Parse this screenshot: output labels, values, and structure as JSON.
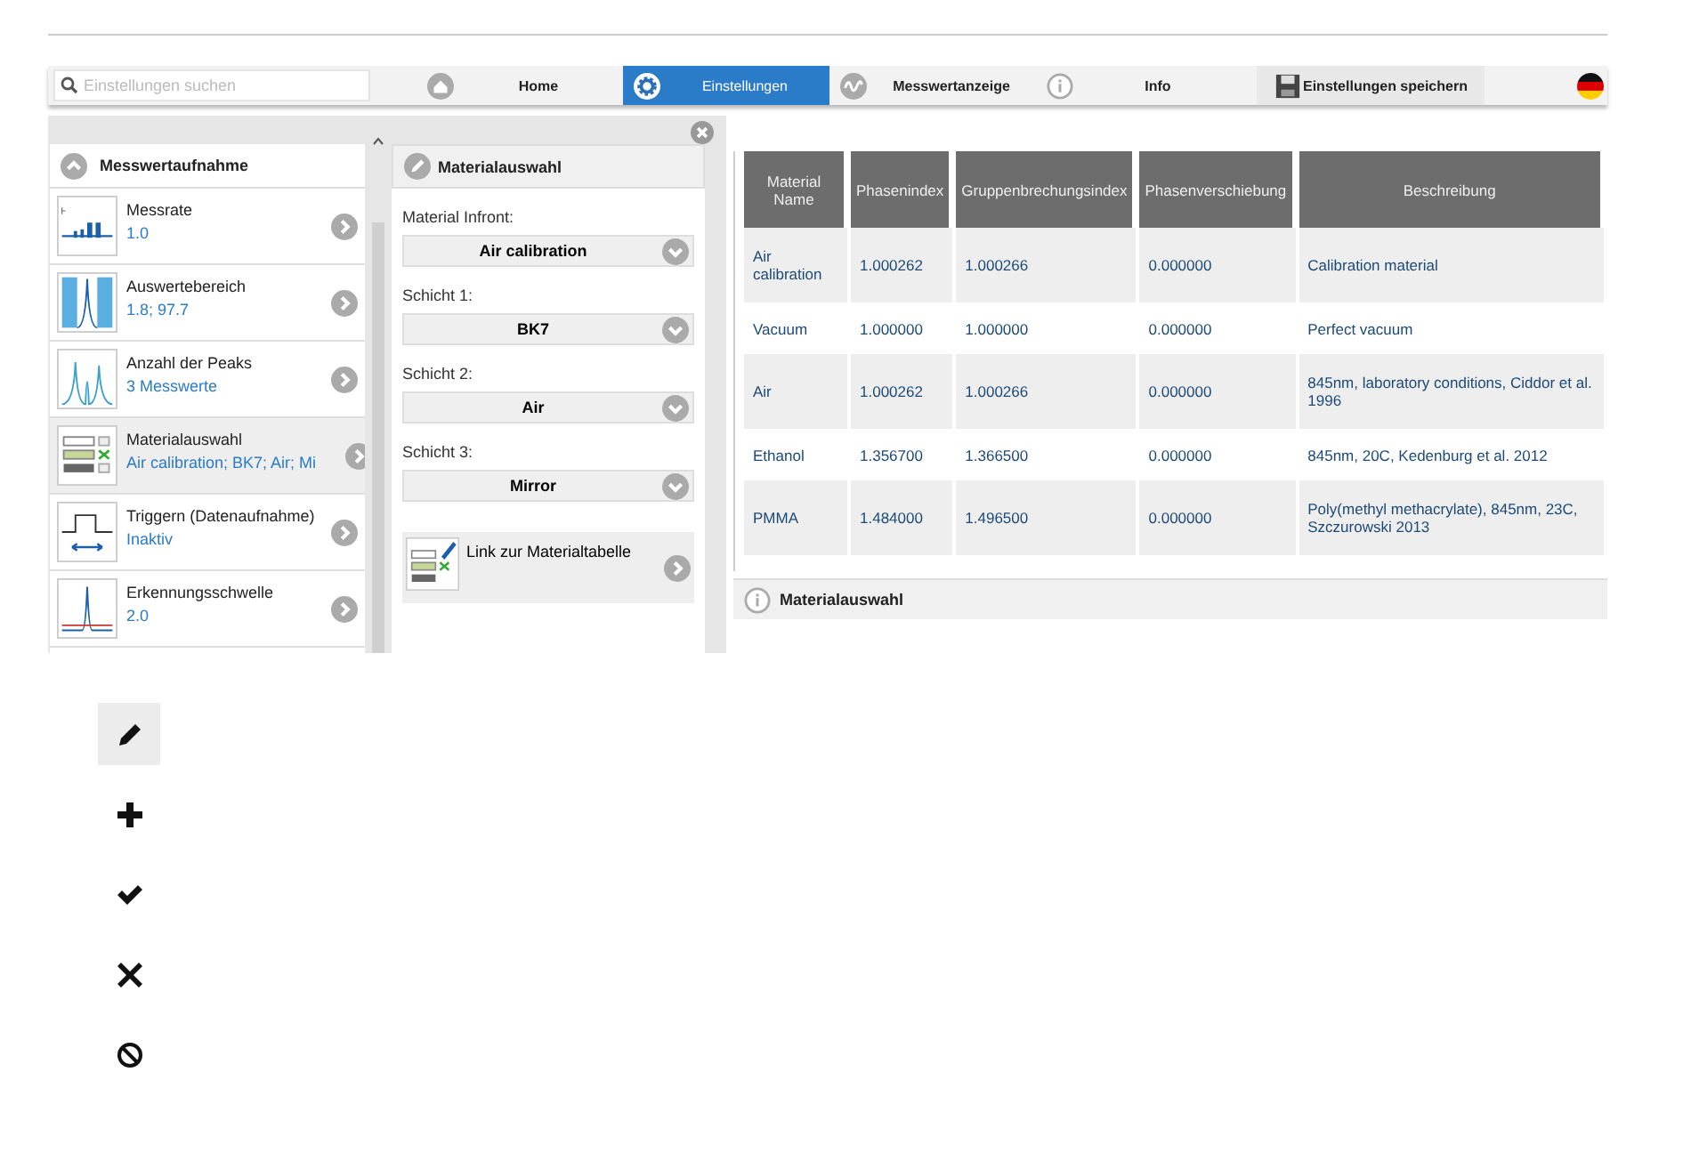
{
  "search": {
    "placeholder": "Einstellungen suchen"
  },
  "nav": [
    {
      "label": "Home",
      "kind": "home",
      "selected": false
    },
    {
      "label": "Einstellungen",
      "kind": "gear",
      "selected": true
    },
    {
      "label": "Messwertanzeige",
      "kind": "wave",
      "selected": false
    },
    {
      "label": "Info",
      "kind": "info",
      "selected": false
    }
  ],
  "save_button": {
    "label": "Einstellungen speichern"
  },
  "settings_list": {
    "title": "Messwertaufnahme",
    "items": [
      {
        "kind": "rate",
        "title": "Messrate",
        "value": "1.0",
        "selected": false
      },
      {
        "kind": "range",
        "title": "Auswertebereich",
        "value": "1.8; 97.7",
        "selected": false
      },
      {
        "kind": "peaks",
        "title": "Anzahl der Peaks",
        "value": "3 Messwerte",
        "selected": false
      },
      {
        "kind": "material",
        "title": "Materialauswahl",
        "value": "Air calibration; BK7; Air; Mi",
        "selected": true
      },
      {
        "kind": "trigger",
        "title": "Triggern (Datenaufnahme)",
        "value": "Inaktiv",
        "selected": false
      },
      {
        "kind": "threshold",
        "title": "Erkennungsschwelle",
        "value": "2.0",
        "selected": false
      }
    ]
  },
  "detail_panel": {
    "title": "Materialauswahl",
    "fields": [
      {
        "label": "Material Infront:",
        "value": "Air calibration"
      },
      {
        "label": "Schicht 1:",
        "value": "BK7"
      },
      {
        "label": "Schicht 2:",
        "value": "Air"
      },
      {
        "label": "Schicht 3:",
        "value": "Mirror"
      }
    ],
    "link": "Link zur Materialtabelle"
  },
  "table": {
    "columns": [
      "Material Name",
      "Phasenindex",
      "Gruppenbrechungsindex",
      "Phasenverschiebung",
      "Beschreibung"
    ],
    "rows": [
      [
        "Air calibration",
        "1.000262",
        "1.000266",
        "0.000000",
        "Calibration material"
      ],
      [
        "Vacuum",
        "1.000000",
        "1.000000",
        "0.000000",
        "Perfect vacuum"
      ],
      [
        "Air",
        "1.000262",
        "1.000266",
        "0.000000",
        "845nm, laboratory conditions, Ciddor et al. 1996"
      ],
      [
        "Ethanol",
        "1.356700",
        "1.366500",
        "0.000000",
        "845nm, 20C, Kedenburg et al. 2012"
      ],
      [
        "PMMA",
        "1.484000",
        "1.496500",
        "0.000000",
        "Poly(methyl methacrylate), 845nm, 23C, Szczurowski 2013"
      ]
    ],
    "footer": "Materialauswahl"
  },
  "icon_legend": [
    {
      "kind": "pencil",
      "selected": true
    },
    {
      "kind": "plus",
      "selected": false
    },
    {
      "kind": "check",
      "selected": false
    },
    {
      "kind": "cross",
      "selected": false
    },
    {
      "kind": "ban",
      "selected": false
    }
  ]
}
